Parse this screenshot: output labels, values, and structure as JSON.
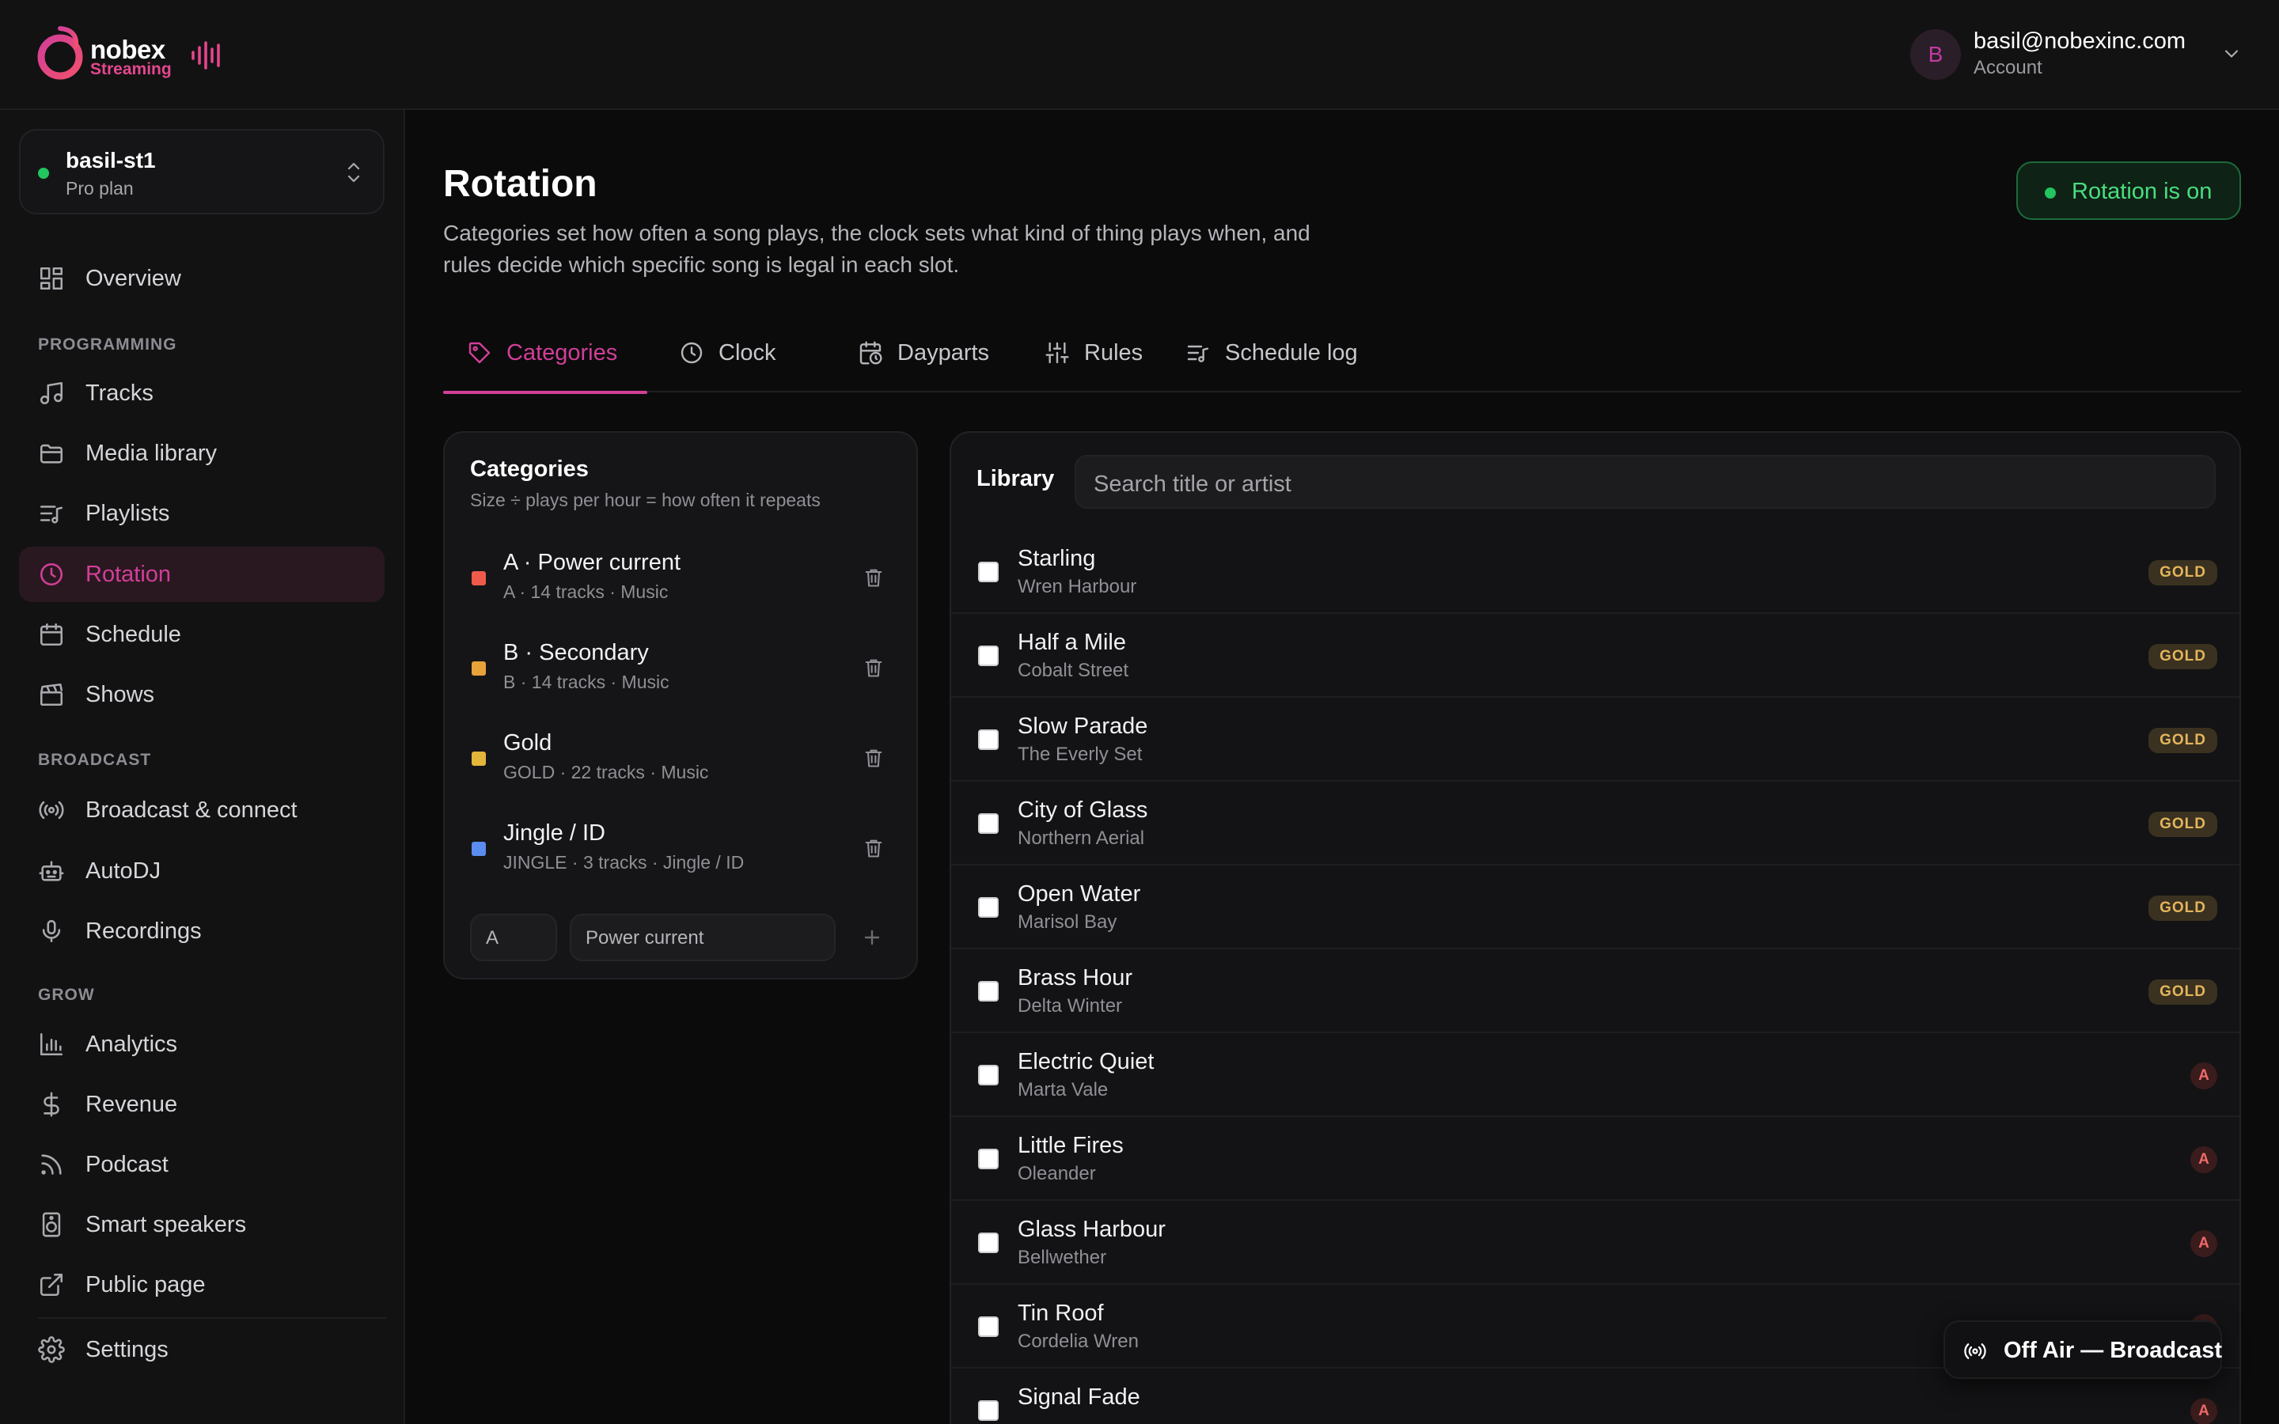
{
  "brand": {
    "name": "nobex",
    "tagline": "Streaming",
    "accent": "#d13f98",
    "logo_pink": "#e5478d"
  },
  "account": {
    "avatar_initial": "B",
    "email": "basil@nobexinc.com",
    "subtitle": "Account"
  },
  "station": {
    "name": "basil-st1",
    "plan": "Pro plan",
    "status_color": "#22c55e"
  },
  "sidebar": {
    "overview": "Overview",
    "sections": {
      "programming": "PROGRAMMING",
      "broadcast": "BROADCAST",
      "grow": "GROW"
    },
    "items": [
      {
        "label": "Tracks",
        "icon": "music-note-icon"
      },
      {
        "label": "Media library",
        "icon": "folder-icon"
      },
      {
        "label": "Playlists",
        "icon": "playlist-icon"
      },
      {
        "label": "Rotation",
        "icon": "clock-icon",
        "active": true
      },
      {
        "label": "Schedule",
        "icon": "calendar-icon"
      },
      {
        "label": "Shows",
        "icon": "clapperboard-icon"
      },
      {
        "label": "Broadcast & connect",
        "icon": "broadcast-icon"
      },
      {
        "label": "AutoDJ",
        "icon": "robot-icon"
      },
      {
        "label": "Recordings",
        "icon": "microphone-icon"
      },
      {
        "label": "Analytics",
        "icon": "bar-chart-icon"
      },
      {
        "label": "Revenue",
        "icon": "dollar-icon"
      },
      {
        "label": "Podcast",
        "icon": "rss-icon"
      },
      {
        "label": "Smart speakers",
        "icon": "speaker-icon"
      },
      {
        "label": "Public page",
        "icon": "external-link-icon"
      }
    ],
    "settings": "Settings"
  },
  "page": {
    "title": "Rotation",
    "description": "Categories set how often a song plays, the clock sets what kind of thing plays when, and rules decide which specific song is legal in each slot.",
    "status": "Rotation is on"
  },
  "tabs": [
    {
      "label": "Categories",
      "icon": "tag-icon",
      "active": true
    },
    {
      "label": "Clock",
      "icon": "clock-icon"
    },
    {
      "label": "Dayparts",
      "icon": "calendar-clock-icon"
    },
    {
      "label": "Rules",
      "icon": "sliders-icon"
    },
    {
      "label": "Schedule log",
      "icon": "list-music-icon"
    }
  ],
  "categories": {
    "title": "Categories",
    "subtitle": "Size ÷ plays per hour = how often it repeats",
    "items": [
      {
        "name": "A · Power current",
        "meta": "A · 14 tracks · Music",
        "color": "#ef5a4a"
      },
      {
        "name": "B · Secondary",
        "meta": "B · 14 tracks · Music",
        "color": "#e8a23a"
      },
      {
        "name": "Gold",
        "meta": "GOLD · 22 tracks · Music",
        "color": "#e3b53a"
      },
      {
        "name": "Jingle / ID",
        "meta": "JINGLE · 3 tracks · Jingle / ID",
        "color": "#5b8def"
      }
    ],
    "new_code_value": "A",
    "new_name_value": "Power current"
  },
  "library": {
    "title": "Library",
    "search_placeholder": "Search title or artist",
    "tracks": [
      {
        "title": "Starling",
        "artist": "Wren Harbour",
        "badge": "GOLD",
        "badge_type": "gold"
      },
      {
        "title": "Half a Mile",
        "artist": "Cobalt Street",
        "badge": "GOLD",
        "badge_type": "gold"
      },
      {
        "title": "Slow Parade",
        "artist": "The Everly Set",
        "badge": "GOLD",
        "badge_type": "gold"
      },
      {
        "title": "City of Glass",
        "artist": "Northern Aerial",
        "badge": "GOLD",
        "badge_type": "gold"
      },
      {
        "title": "Open Water",
        "artist": "Marisol Bay",
        "badge": "GOLD",
        "badge_type": "gold"
      },
      {
        "title": "Brass Hour",
        "artist": "Delta Winter",
        "badge": "GOLD",
        "badge_type": "gold"
      },
      {
        "title": "Electric Quiet",
        "artist": "Marta Vale",
        "badge": "A",
        "badge_type": "a"
      },
      {
        "title": "Little Fires",
        "artist": "Oleander",
        "badge": "A",
        "badge_type": "a"
      },
      {
        "title": "Glass Harbour",
        "artist": "Bellwether",
        "badge": "A",
        "badge_type": "a"
      },
      {
        "title": "Tin Roof",
        "artist": "Cordelia Wren",
        "badge": "A",
        "badge_type": "a"
      },
      {
        "title": "Signal Fade",
        "artist": "",
        "badge": "A",
        "badge_type": "a"
      }
    ]
  },
  "broadcast_button": "Off Air — Broadcast"
}
